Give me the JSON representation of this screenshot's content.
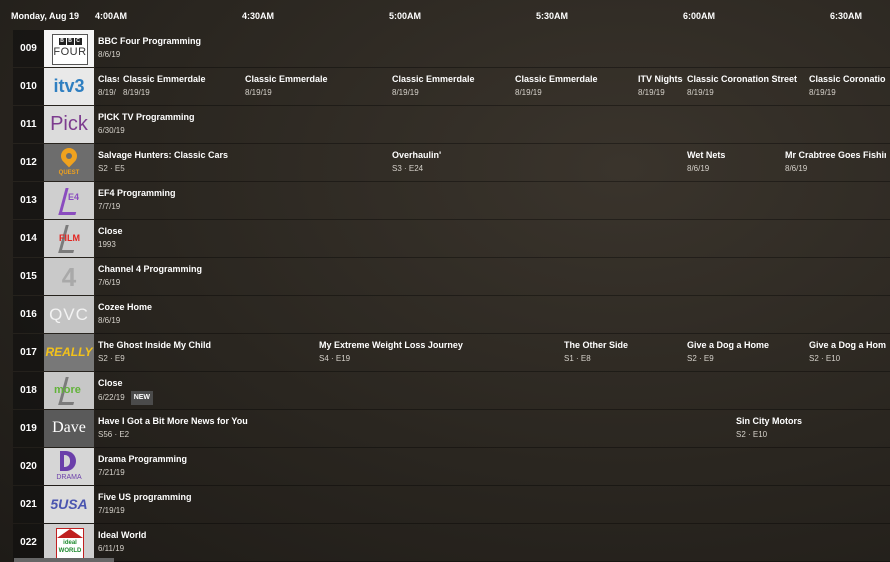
{
  "header": {
    "date": "Monday, Aug 19",
    "times": [
      "4:00AM",
      "4:30AM",
      "5:00AM",
      "5:30AM",
      "6:00AM",
      "6:30AM"
    ]
  },
  "channels": [
    {
      "number": "009",
      "logo": "bbc-four",
      "logo_text": "FOUR",
      "programs": [
        {
          "title": "BBC Four Programming",
          "sub": "8/6/19"
        }
      ]
    },
    {
      "number": "010",
      "logo": "itv3",
      "logo_text": "itv3",
      "programs": [
        {
          "title": "Class",
          "sub": "8/19/"
        },
        {
          "title": "Classic Emmerdale",
          "sub": "8/19/19"
        },
        {
          "title": "Classic Emmerdale",
          "sub": "8/19/19"
        },
        {
          "title": "Classic Emmerdale",
          "sub": "8/19/19"
        },
        {
          "title": "Classic Emmerdale",
          "sub": "8/19/19"
        },
        {
          "title": "ITV Nightsc",
          "sub": "8/19/19"
        },
        {
          "title": "Classic Coronation Street",
          "sub": "8/19/19"
        },
        {
          "title": "Classic Coronation S",
          "sub": "8/19/19"
        }
      ]
    },
    {
      "number": "011",
      "logo": "pick",
      "logo_text": "Pick",
      "programs": [
        {
          "title": "PICK TV Programming",
          "sub": "6/30/19"
        }
      ]
    },
    {
      "number": "012",
      "logo": "quest",
      "logo_text": "QUEST",
      "programs": [
        {
          "title": "Salvage Hunters: Classic Cars",
          "sub": "S2 · E5"
        },
        {
          "title": "Overhaulin'",
          "sub": "S3 · E24"
        },
        {
          "title": "Wet Nets",
          "sub": "8/6/19"
        },
        {
          "title": "Mr Crabtree Goes Fishing",
          "sub": "8/6/19"
        }
      ]
    },
    {
      "number": "013",
      "logo": "e4",
      "logo_text": "E4",
      "programs": [
        {
          "title": "EF4 Programming",
          "sub": "7/7/19"
        }
      ]
    },
    {
      "number": "014",
      "logo": "film4",
      "logo_text": "FILM",
      "programs": [
        {
          "title": "Close",
          "sub": "1993"
        }
      ]
    },
    {
      "number": "015",
      "logo": "channel4",
      "logo_text": "4",
      "programs": [
        {
          "title": "Channel 4 Programming",
          "sub": "7/6/19"
        }
      ]
    },
    {
      "number": "016",
      "logo": "qvc",
      "logo_text": "QVC",
      "programs": [
        {
          "title": "Cozee Home",
          "sub": "8/6/19"
        }
      ]
    },
    {
      "number": "017",
      "logo": "really",
      "logo_text": "REALLY",
      "programs": [
        {
          "title": "The Ghost Inside My Child",
          "sub": "S2 · E9"
        },
        {
          "title": "My Extreme Weight Loss Journey",
          "sub": "S4 · E19"
        },
        {
          "title": "The Other Side",
          "sub": "S1 · E8"
        },
        {
          "title": "Give a Dog a Home",
          "sub": "S2 · E9"
        },
        {
          "title": "Give a Dog a Home",
          "sub": "S2 · E10"
        }
      ]
    },
    {
      "number": "018",
      "logo": "4more",
      "logo_text": "more",
      "programs": [
        {
          "title": "Close",
          "sub": "6/22/19",
          "badge": "NEW"
        }
      ]
    },
    {
      "number": "019",
      "logo": "dave",
      "logo_text": "Dave",
      "programs": [
        {
          "title": "Have I Got a Bit More News for You",
          "sub": "S56 · E2"
        },
        {
          "title": "Sin City Motors",
          "sub": "S2 · E10"
        }
      ]
    },
    {
      "number": "020",
      "logo": "drama",
      "logo_text": "DRAMA",
      "programs": [
        {
          "title": "Drama Programming",
          "sub": "7/21/19"
        }
      ]
    },
    {
      "number": "021",
      "logo": "5usa",
      "logo_text": "5USA",
      "programs": [
        {
          "title": "Five US programming",
          "sub": "7/19/19"
        }
      ]
    },
    {
      "number": "022",
      "logo": "ideal-world",
      "logo_text": "ideal WORLD",
      "programs": [
        {
          "title": "Ideal World",
          "sub": "6/11/19"
        }
      ]
    }
  ]
}
